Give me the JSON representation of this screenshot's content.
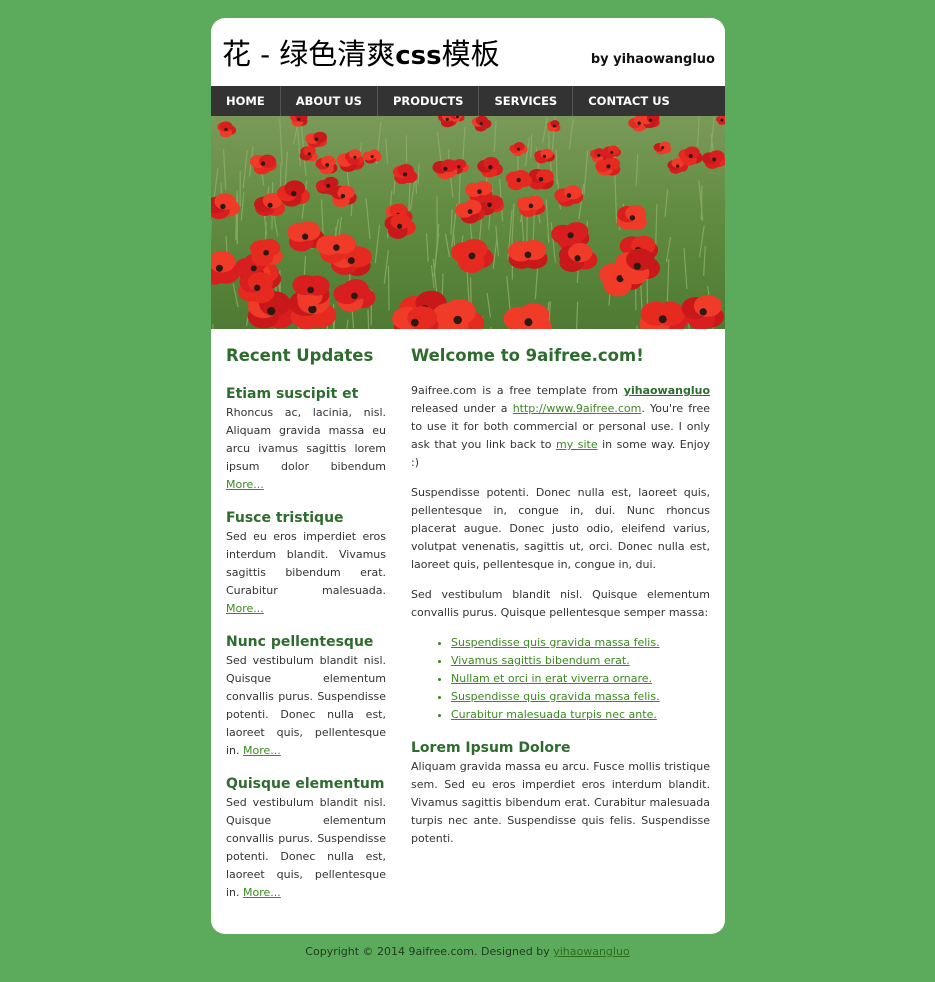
{
  "header": {
    "title_prefix": "花 - 绿色清爽",
    "title_css": "css",
    "title_suffix": "模板",
    "byline": "by yihaowangluo"
  },
  "nav": {
    "items": [
      {
        "label": "HOME"
      },
      {
        "label": "ABOUT US"
      },
      {
        "label": "PRODUCTS"
      },
      {
        "label": "SERVICES"
      },
      {
        "label": "CONTACT US"
      }
    ]
  },
  "sidebar": {
    "title": "Recent Updates",
    "more_label": "More...",
    "posts": [
      {
        "title": "Etiam suscipit et",
        "text": "Rhoncus ac, lacinia, nisl. Aliquam gravida massa eu arcu ivamus sagittis lorem ipsum dolor bibendum"
      },
      {
        "title": "Fusce tristique",
        "text": "Sed eu eros imperdiet eros interdum blandit. Vivamus sagittis bibendum erat. Curabitur malesuada."
      },
      {
        "title": "Nunc pellentesque",
        "text": "Sed vestibulum blandit nisl. Quisque elementum convallis purus. Suspendisse potenti. Donec nulla est, laoreet quis, pellentesque in."
      },
      {
        "title": "Quisque elementum",
        "text": "Sed vestibulum blandit nisl. Quisque elementum convallis purus. Suspendisse potenti. Donec nulla est, laoreet quis, pellentesque in."
      }
    ]
  },
  "main": {
    "title": "Welcome to 9aifree.com!",
    "intro": {
      "t1": "9aifree.com is a free template from ",
      "link1": "yihaowangluo",
      "t2": " released under a ",
      "link2": "http://www.9aifree.com",
      "t3": ". You're free to use it for both commercial or personal use. I only ask that you link back to ",
      "link3": "my site",
      "t4": " in some way. Enjoy :)"
    },
    "para2": "Suspendisse potenti. Donec nulla est, laoreet quis, pellentesque in, congue in, dui. Nunc rhoncus placerat augue. Donec justo odio, eleifend varius, volutpat venenatis, sagittis ut, orci. Donec nulla est, laoreet quis, pellentesque in, congue in, dui.",
    "para3": "Sed vestibulum blandit nisl. Quisque elementum convallis purus. Quisque pellentesque semper massa:",
    "list": [
      "Suspendisse quis gravida massa felis.",
      "Vivamus sagittis bibendum erat.",
      "Nullam et orci in erat viverra ornare.",
      "Suspendisse quis gravida massa felis.",
      "Curabitur malesuada turpis nec ante."
    ],
    "subtitle": "Lorem Ipsum Dolore",
    "para4": "Aliquam gravida massa eu arcu. Fusce mollis tristique sem. Sed eu eros imperdiet eros interdum blandit. Vivamus sagittis bibendum erat. Curabitur malesuada turpis nec ante. Suspendisse quis felis. Suspendisse potenti."
  },
  "footer": {
    "text": "Copyright © 2014 9aifree.com. Designed by ",
    "link": "yihaowangluo"
  },
  "colors": {
    "background": "#5cab5c",
    "nav": "#333333",
    "heading": "#2e6b2e",
    "link": "#3a8a1f"
  }
}
